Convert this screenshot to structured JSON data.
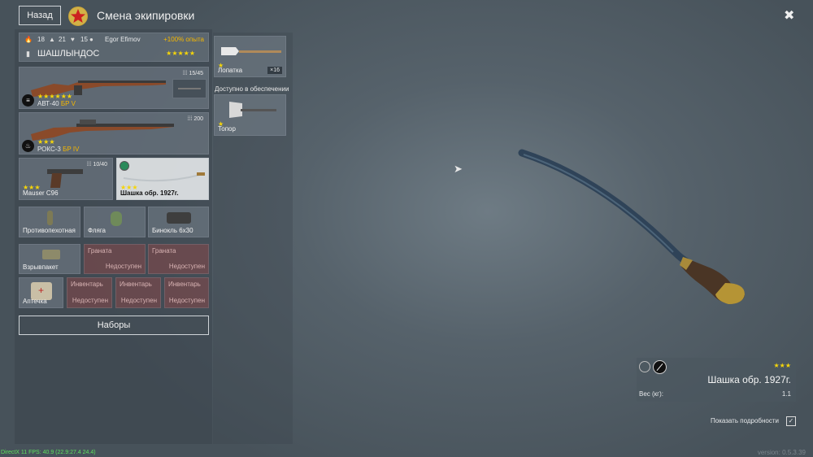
{
  "header": {
    "back_label": "Назад",
    "title": "Смена экипировки"
  },
  "soldier": {
    "stat1": "18",
    "stat2": "21",
    "stat3": "15",
    "player": "Egor Efimov",
    "bonus": "+100% опыта",
    "name": "ШАШЛЫНДОС",
    "stars": "★★★★★"
  },
  "weapons": [
    {
      "name": "АВТ-40",
      "br": "БР V",
      "stars": "★★★★★★",
      "ammo": "15/45"
    },
    {
      "name": "РОКС-3",
      "br": "БР IV",
      "stars": "★★★",
      "ammo": "200"
    }
  ],
  "secondary": [
    {
      "name": "Mauser C96",
      "stars": "★★★",
      "ammo": "10/40"
    },
    {
      "name": "Шашка обр. 1927г.",
      "stars": "★★★"
    }
  ],
  "equipment": [
    "Противопехотная",
    "Фляга",
    "Бинокль 6x30"
  ],
  "row4": {
    "explosive": "Взрывпакет",
    "grenade_label": "Граната",
    "unavailable": "Недоступен"
  },
  "row5": {
    "medkit": "Аптечка",
    "inventory_label": "Инвентарь",
    "unavailable": "Недоступен"
  },
  "kits_label": "Наборы",
  "tools": {
    "shovel": "Лопатка",
    "shovel_count": "×16",
    "available_header": "Доступно в обеспечении",
    "axe": "Топор"
  },
  "detail": {
    "stars": "★★★",
    "name": "Шашка обр. 1927г.",
    "weight_label": "Вес (кг):",
    "weight_value": "1.1",
    "show_details": "Показать подробности"
  },
  "debug": {
    "fps": "DirectX 11 FPS: 40.9 (22.9:27.4 24.4)",
    "version": "version: 0.5.3.39"
  }
}
